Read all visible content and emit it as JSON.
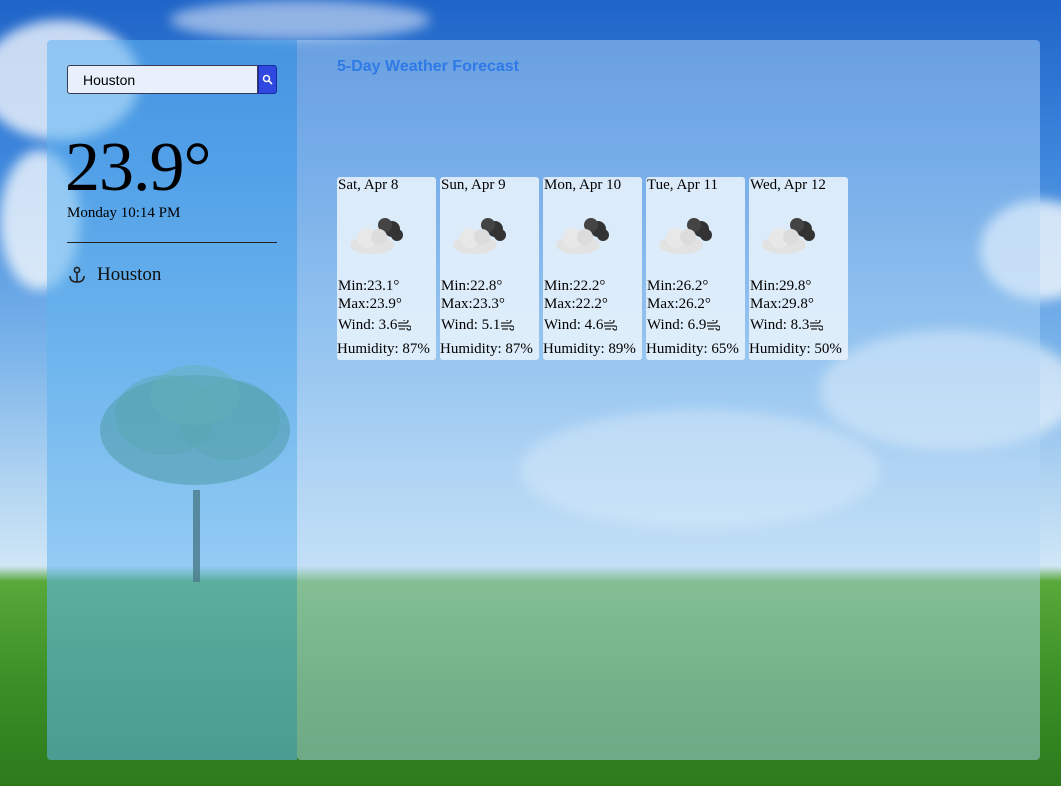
{
  "search": {
    "value": "Houston"
  },
  "current": {
    "temp": "23.9°",
    "datetime": "Monday 10:14 PM",
    "city": "Houston"
  },
  "forecast": {
    "title": "5-Day Weather Forecast",
    "days": [
      {
        "date": "Sat, Apr 8",
        "min": "Min:23.1°",
        "max": "Max:23.9°",
        "wind": "Wind: 3.6",
        "humidity": "Humidity: 87%"
      },
      {
        "date": "Sun, Apr 9",
        "min": "Min:22.8°",
        "max": "Max:23.3°",
        "wind": "Wind: 5.1",
        "humidity": "Humidity: 87%"
      },
      {
        "date": "Mon, Apr 10",
        "min": "Min:22.2°",
        "max": "Max:22.2°",
        "wind": "Wind: 4.6",
        "humidity": "Humidity: 89%"
      },
      {
        "date": "Tue, Apr 11",
        "min": "Min:26.2°",
        "max": "Max:26.2°",
        "wind": "Wind: 6.9",
        "humidity": "Humidity: 65%"
      },
      {
        "date": "Wed, Apr 12",
        "min": "Min:29.8°",
        "max": "Max:29.8°",
        "wind": "Wind: 8.3",
        "humidity": "Humidity: 50%"
      }
    ],
    "icon": "partly-cloudy-night-icon"
  },
  "colors": {
    "accent": "#2f7ae6",
    "search_button": "#2e48e0"
  }
}
